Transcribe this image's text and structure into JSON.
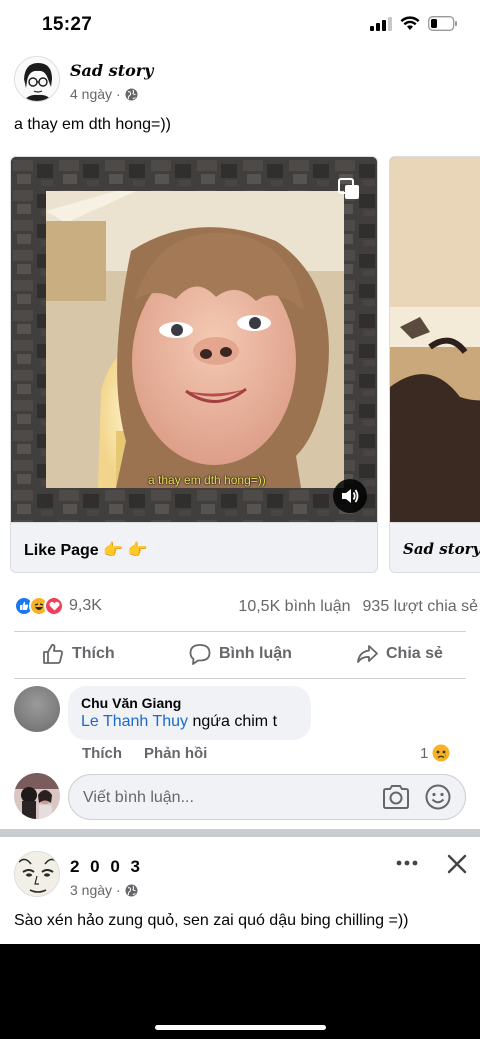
{
  "status": {
    "time": "15:27"
  },
  "post": {
    "author": "Sad story",
    "time": "4 ngày",
    "privacy_icon": "globe-icon",
    "text": "a thay em dth hong=))"
  },
  "carousel": {
    "cards": [
      {
        "caption": "a thay em dth hong=))",
        "footer": "Like Page 👉 👉"
      },
      {
        "footer": "Sad story"
      }
    ]
  },
  "stats": {
    "reaction_icons": [
      "like-reaction-icon",
      "haha-reaction-icon",
      "love-reaction-icon"
    ],
    "reactions": "9,3K",
    "comments": "10,5K bình luận",
    "shares": "935 lượt chia sẻ"
  },
  "actions": {
    "like": "Thích",
    "comment": "Bình luận",
    "share": "Chia sẻ"
  },
  "comment": {
    "author": "Chu Văn Giang",
    "mention": "Le Thanh Thuy",
    "text": " ngứa chim t",
    "like": "Thích",
    "reply": "Phản hồi",
    "reaction_count": "1",
    "reaction_icon": "sad-reaction-icon"
  },
  "composer": {
    "placeholder": "Viết bình luận..."
  },
  "post2": {
    "author": "2 0 0 3",
    "time": "3 ngày",
    "text": "Sào xén hảo zung quỏ, sen zai quó dậu bing chilling =))"
  },
  "colors": {
    "accent": "#1877f2",
    "muted": "#65676b",
    "mention": "#1b6ac9",
    "divider": "#ced0d4"
  }
}
